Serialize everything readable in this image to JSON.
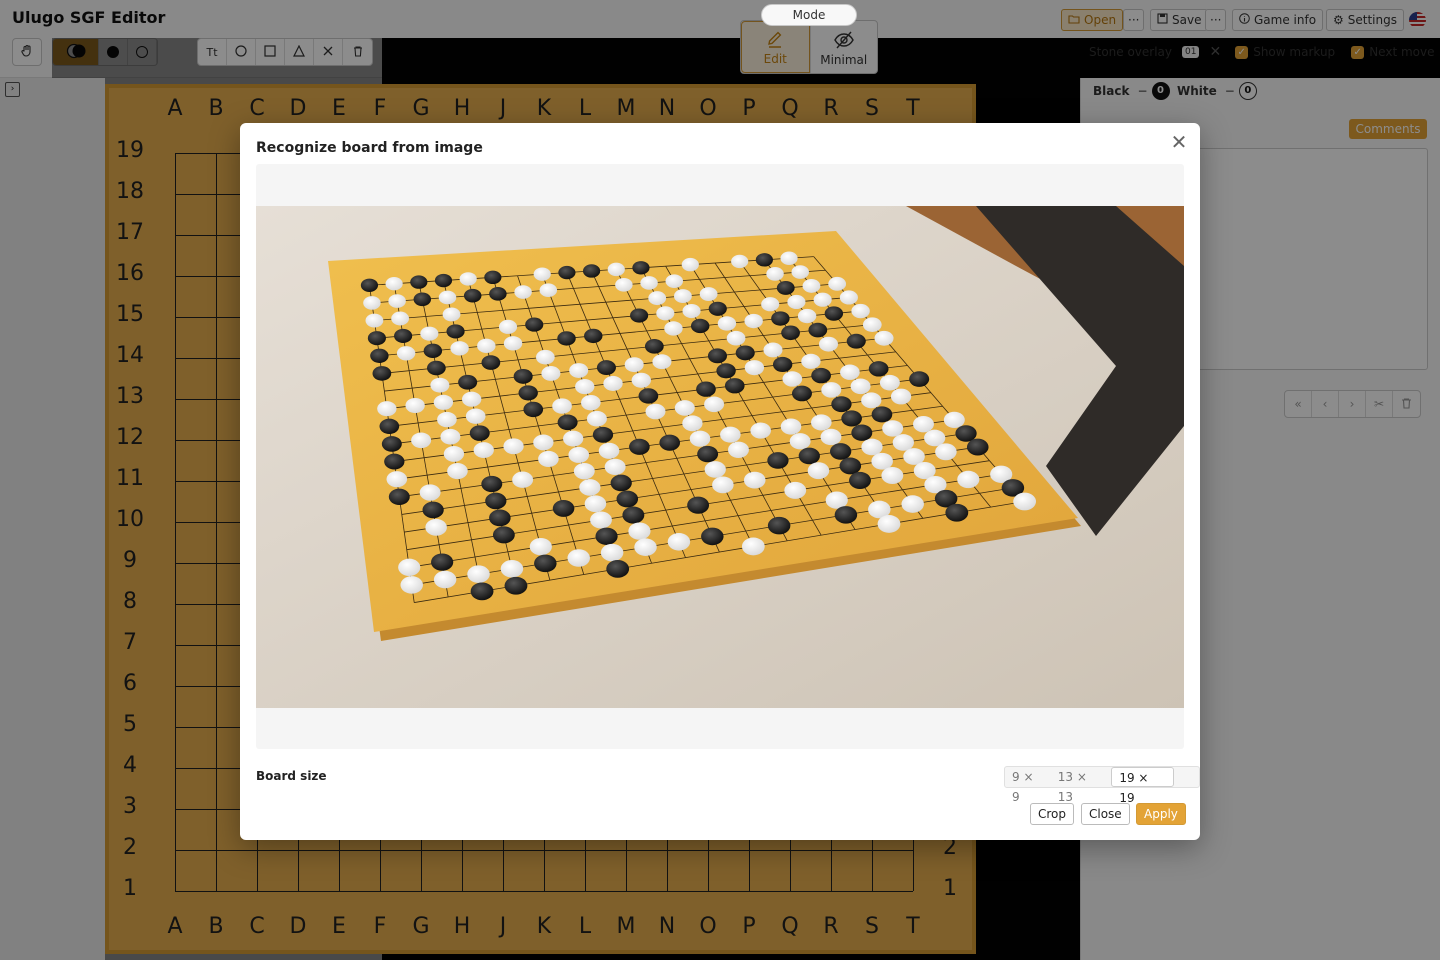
{
  "app": {
    "title": "Ulugo SGF Editor"
  },
  "mode": {
    "label": "Mode",
    "edit": "Edit",
    "minimal": "Minimal"
  },
  "header_buttons": {
    "open": "Open",
    "more": "···",
    "save": "Save",
    "game_info": "Game info",
    "settings": "Settings"
  },
  "overlay": {
    "stone_overlay": "Stone overlay",
    "overlay_value": "01",
    "show_markup": "Show markup",
    "next_move": "Next move"
  },
  "score": {
    "black_label": "Black",
    "black_value": "0",
    "white_label": "White",
    "white_value": "0",
    "dash": "−"
  },
  "comments": {
    "tab": "Comments"
  },
  "board": {
    "columns": [
      "A",
      "B",
      "C",
      "D",
      "E",
      "F",
      "G",
      "H",
      "J",
      "K",
      "L",
      "M",
      "N",
      "O",
      "P",
      "Q",
      "R",
      "S",
      "T"
    ],
    "rows": [
      "19",
      "18",
      "17",
      "16",
      "15",
      "14",
      "13",
      "12",
      "11",
      "10",
      "9",
      "8",
      "7",
      "6",
      "5",
      "4",
      "3",
      "2",
      "1"
    ],
    "visible_right_rows": [
      "2",
      "1"
    ]
  },
  "modal": {
    "title": "Recognize board from image",
    "board_size_label": "Board size",
    "sizes": [
      "9 × 9",
      "13 × 13",
      "19 × 19"
    ],
    "selected_size": "19 × 19",
    "crop": "Crop",
    "close": "Close",
    "apply": "Apply"
  },
  "colors": {
    "accent": "#e3a336",
    "board": "#e8b04f"
  }
}
